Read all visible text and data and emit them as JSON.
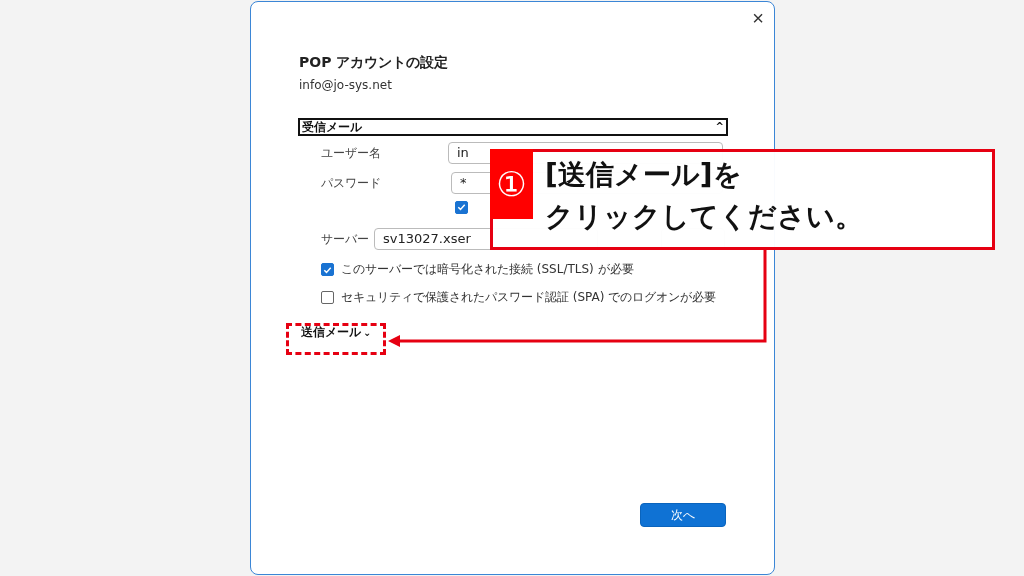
{
  "dialog": {
    "close": "×",
    "title": "POP アカウントの設定",
    "email": "info@jo-sys.net",
    "incoming": {
      "header": "受信メール",
      "caret": "^",
      "expanded": true,
      "username": {
        "label": "ユーザー名",
        "value": "in"
      },
      "password": {
        "label": "パスワード",
        "value": "*"
      },
      "save_password": {
        "checked": true
      },
      "server": {
        "label": "サーバー",
        "value": "sv13027.xser"
      },
      "options": [
        {
          "label": "このサーバーでは暗号化された接続 (SSL/TLS) が必要",
          "checked": true
        },
        {
          "label": "セキュリティで保護されたパスワード認証 (SPA) でのログオンが必要",
          "checked": false
        }
      ]
    },
    "outgoing": {
      "header": "送信メール",
      "caret": "⌄",
      "expanded": false
    },
    "next_button": "次へ"
  },
  "callout": {
    "number": "①",
    "lines": [
      "[送信メール]を",
      "クリックしてください。"
    ]
  }
}
